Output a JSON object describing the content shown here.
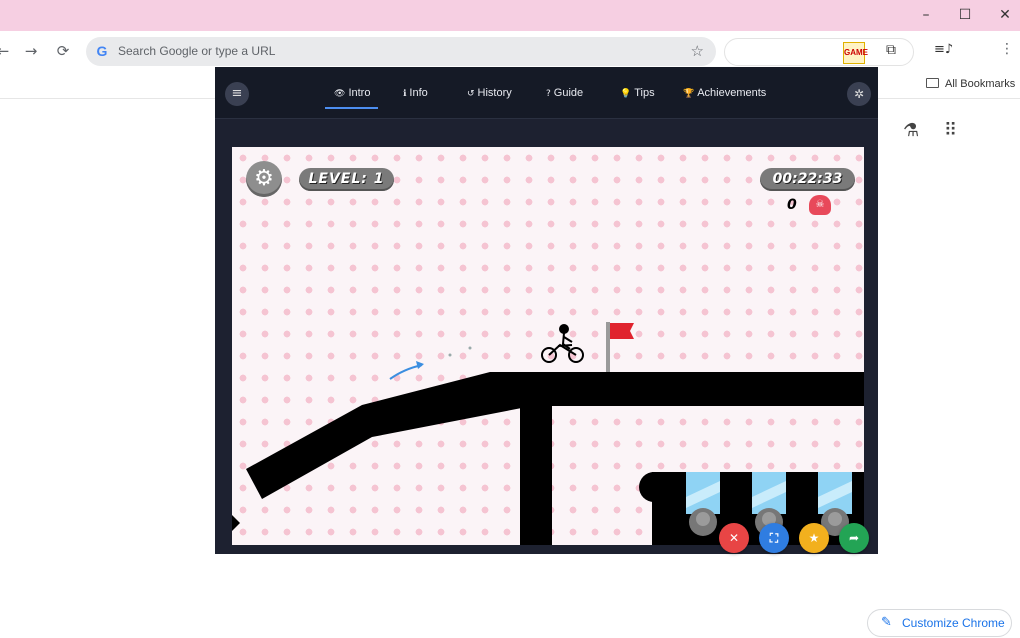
{
  "window": {
    "controls": {
      "minimize": "–",
      "maximize": "☐",
      "close": "✕"
    }
  },
  "toolbar": {
    "back": "←",
    "forward": "→",
    "reload": "⟳",
    "omnibox": {
      "google_icon": "G",
      "placeholder": "Search Google or type a URL",
      "star": "☆"
    },
    "extension_puzzle": "⧉",
    "media_icon": "≡♪",
    "menu": "⋮"
  },
  "bookmarks": {
    "all_bookmarks": "All Bookmarks"
  },
  "ntp": {
    "labs_icon": "⚗",
    "apps_icon": "⠿",
    "customize_label": "Customize Chrome",
    "customize_icon": "✎"
  },
  "popup": {
    "menu_icon": "≡",
    "settings_icon": "✲",
    "tabs": [
      {
        "label": "Intro",
        "icon": "👁",
        "active": true
      },
      {
        "label": "Info",
        "icon": "ℹ",
        "active": false
      },
      {
        "label": "History",
        "icon": "↺",
        "active": false
      },
      {
        "label": "Guide",
        "icon": "?",
        "active": false
      },
      {
        "label": "Tips",
        "icon": "💡",
        "active": false
      },
      {
        "label": "Achievements",
        "icon": "🏆",
        "active": false
      }
    ]
  },
  "game": {
    "settings_icon": "⚙",
    "level_label": "LEVEL: 1",
    "timer": "00:22:33",
    "deaths": "0",
    "skull_icon": "☠",
    "flag_color": "#e0232e",
    "buttons": [
      {
        "name": "close",
        "icon": "✕",
        "color": "#e84545"
      },
      {
        "name": "fullscreen",
        "icon": "⛶",
        "color": "#2f7de1"
      },
      {
        "name": "favorite",
        "icon": "★",
        "color": "#f2b01e"
      },
      {
        "name": "share",
        "icon": "➦",
        "color": "#23a455"
      }
    ]
  }
}
